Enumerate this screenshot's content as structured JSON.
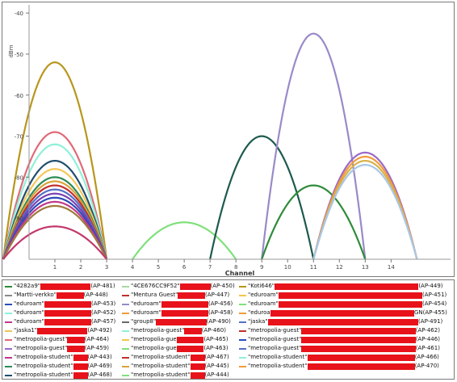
{
  "chart_data": {
    "type": "line",
    "ylabel": "dBm",
    "xlabel": "Channel",
    "ylim": [
      -100,
      -38
    ],
    "xlim": [
      0,
      16.3
    ],
    "yticks": [
      -40,
      -50,
      -60,
      -70,
      -80,
      -90
    ],
    "xticks": [
      1,
      2,
      3,
      4,
      5,
      6,
      7,
      8,
      9,
      10,
      11,
      12,
      13,
      14
    ],
    "grid": false,
    "series": [
      {
        "channel": 1,
        "peak": -52,
        "color": "#b8961c"
      },
      {
        "channel": 1,
        "peak": -69,
        "color": "#e06a78"
      },
      {
        "channel": 1,
        "peak": -72,
        "color": "#8ff0d8"
      },
      {
        "channel": 1,
        "peak": -76,
        "color": "#1f4e6e"
      },
      {
        "channel": 1,
        "peak": -78,
        "color": "#f4c75a"
      },
      {
        "channel": 1,
        "peak": -80,
        "color": "#2e8b57"
      },
      {
        "channel": 1,
        "peak": -81,
        "color": "#d9a23a"
      },
      {
        "channel": 1,
        "peak": -82,
        "color": "#c22f2f"
      },
      {
        "channel": 1,
        "peak": -83,
        "color": "#5470c6"
      },
      {
        "channel": 1,
        "peak": -84,
        "color": "#7b3fb0"
      },
      {
        "channel": 1,
        "peak": -85,
        "color": "#2a4db8"
      },
      {
        "channel": 1,
        "peak": -86,
        "color": "#c0388a"
      },
      {
        "channel": 1,
        "peak": -87,
        "color": "#a07a3c"
      },
      {
        "channel": 1,
        "peak": -92,
        "color": "#c2386c"
      },
      {
        "channel": 6,
        "peak": -91,
        "color": "#7fe07a"
      },
      {
        "channel": 9,
        "peak": -70,
        "color": "#1e5a4e"
      },
      {
        "channel": 11,
        "peak": -45,
        "color": "#9a8ac8"
      },
      {
        "channel": 11,
        "peak": -82,
        "color": "#2e8b3a"
      },
      {
        "channel": 13,
        "peak": -74,
        "color": "#9a6ac8"
      },
      {
        "channel": 13,
        "peak": -75,
        "color": "#f29a3a"
      },
      {
        "channel": 13,
        "peak": -76,
        "color": "#d9b24a"
      },
      {
        "channel": 13,
        "peak": -77,
        "color": "#a8c8e8"
      }
    ]
  },
  "legend": {
    "rows": [
      [
        {
          "name": "\"4282a9\"",
          "ap": "(AP-481)",
          "color": "#2e8b3a"
        },
        {
          "name": "\"4CE676CC9F52\"",
          "ap": "(AP-450)",
          "color": "#a8d8a0"
        },
        {
          "name": "\"Koti646\"",
          "ap": "(AP-449)",
          "color": "#b8961c"
        }
      ],
      [
        {
          "name": "\"Martti-verkko\"",
          "ap": "(AP-448)",
          "color": "#8a8a8a"
        },
        {
          "name": "\"Mentura Guest\"",
          "ap": "(AP-447)",
          "color": "#c22f2f"
        },
        {
          "name": "\"eduroam\"",
          "ap": "(AP-451)",
          "color": "#f2c64a"
        }
      ],
      [
        {
          "name": "\"eduroam\"",
          "ap": "(AP-453)",
          "color": "#2a4db8"
        },
        {
          "name": "\"eduroam\"",
          "ap": "(AP-456)",
          "color": "#9a8ac8"
        },
        {
          "name": "\"eduroam\"",
          "ap": "(AP-454)",
          "color": "#7fe07a"
        }
      ],
      [
        {
          "name": "\"eduroam\"",
          "ap": "(AP-452)",
          "color": "#8ff0d8"
        },
        {
          "name": "\"eduroam\"",
          "ap": "(AP-458)",
          "color": "#f29a3a"
        },
        {
          "name": "\"eduroa",
          "ap": "GN(AP-455)",
          "color": "#f29a3a"
        }
      ],
      [
        {
          "name": "\"eduroam\"",
          "ap": "(AP-457)",
          "color": "#c0388a"
        },
        {
          "name": "\"group8\"",
          "ap": "(AP-490)",
          "color": "#6a6a6a"
        },
        {
          "name": "\"jaska\"",
          "ap": "(AP-491)",
          "color": "#5470c6"
        }
      ],
      [
        {
          "name": "\"jaska1\"",
          "ap": "(AP-492)",
          "color": "#e6c85a"
        },
        {
          "name": "\"metropolia-guest\"",
          "ap": "(AP-460)",
          "color": "#8ff0d8"
        },
        {
          "name": "\"metropolia-guest\"",
          "ap": "(AP-462)",
          "color": "#c22f2f"
        }
      ],
      [
        {
          "name": "\"metropolia-guest\"",
          "ap": "(AP-464)",
          "color": "#e06a78"
        },
        {
          "name": "\"metropolia-gue",
          "ap": "(AP-465)",
          "color": "#f2c64a"
        },
        {
          "name": "\"metropolia-guest\"",
          "ap": "(AP-446)",
          "color": "#2a4db8"
        }
      ],
      [
        {
          "name": "\"metropolia-guest\"",
          "ap": "(AP-459)",
          "color": "#9a6ac8"
        },
        {
          "name": "\"metropolia-gue",
          "ap": "(AP-463)",
          "color": "#7fe07a"
        },
        {
          "name": "\"metropolia-guest\"",
          "ap": "(AP-461)",
          "color": "#5470c6"
        }
      ],
      [
        {
          "name": "\"metropolia-student\"",
          "ap": "(AP-443)",
          "color": "#c0388a"
        },
        {
          "name": "\"metropolia-student\"",
          "ap": "(AP-467)",
          "color": "#c22f2f"
        },
        {
          "name": "\"metropolia-student\"",
          "ap": "(AP-466)",
          "color": "#8ff0d8"
        }
      ],
      [
        {
          "name": "\"metropolia-student\"",
          "ap": "(AP-469)",
          "color": "#2e8b57"
        },
        {
          "name": "\"metropolia-student\"",
          "ap": "(AP-445)",
          "color": "#d9a23a"
        },
        {
          "name": "\"metropolia-student\"",
          "ap": "(AP-470)",
          "color": "#f29a3a"
        }
      ],
      [
        {
          "name": "\"metropolia-student\"",
          "ap": "(AP-468)",
          "color": "#1f4e6e"
        },
        {
          "name": "\"metropolia-student\"",
          "ap": "(AP-444)",
          "color": "#7fe07a"
        }
      ]
    ]
  }
}
